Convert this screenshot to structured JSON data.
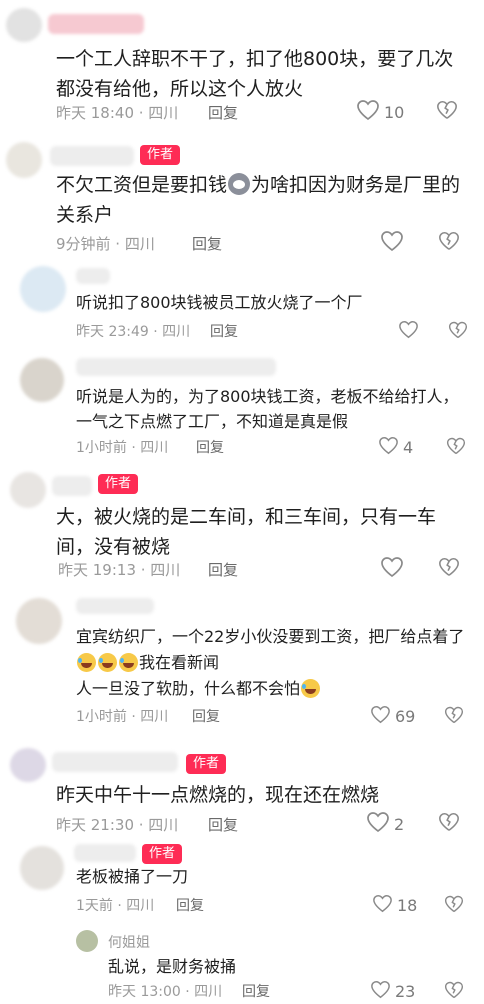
{
  "colors": {
    "accent": "#fe2c55",
    "meta": "#9a9a9a",
    "text": "#1f1f1f"
  },
  "comments": [
    {
      "author_badge": "",
      "text": "一个工人辞职不干了，扣了他800块，要了几次都没有给他，所以这个人放火",
      "time": "昨天 18:40 · 四川",
      "reply": "回复",
      "likes": "10"
    },
    {
      "author_badge": "作者",
      "text_a": "不欠工资但是要扣钱",
      "emoji": "cat-emoji",
      "text_b": "为啥扣因为财务是厂里的关系户",
      "time": "9分钟前 · 四川",
      "reply": "回复",
      "likes": ""
    },
    {
      "author_badge": "",
      "text": "听说扣了800块钱被员工放火烧了一个厂",
      "time": "昨天 23:49 · 四川",
      "reply": "回复",
      "likes": ""
    },
    {
      "author_badge": "",
      "text": "听说是人为的，为了800块钱工资，老板不给给打人，一气之下点燃了工厂，不知道是真是假",
      "time": "1小时前 · 四川",
      "reply": "回复",
      "likes": "4"
    },
    {
      "author_badge": "作者",
      "text": "大，被火烧的是二车间，和三车间，只有一车间，没有被烧",
      "time": "昨天 19:13 · 四川",
      "reply": "回复",
      "likes": ""
    },
    {
      "author_badge": "",
      "text_a": "宜宾纺织厂，一个22岁小伙没要到工资，把厂给点着了",
      "emoji": "laughing-tears-emoji",
      "text_b": "我在看新闻",
      "text_c": "人一旦没了软肋，什么都不会怕",
      "time": "1小时前 · 四川",
      "reply": "回复",
      "likes": "69"
    },
    {
      "author_badge": "作者",
      "text": "昨天中午十一点燃烧的，现在还在燃烧",
      "time": "昨天 21:30 · 四川",
      "reply": "回复",
      "likes": "2"
    },
    {
      "author_badge": "作者",
      "text": "老板被捅了一刀",
      "time": "1天前 · 四川",
      "reply": "回复",
      "likes": "18"
    },
    {
      "author": "何姐姐",
      "text": "乱说，是财务被捅",
      "time": "昨天 13:00 · 四川",
      "reply": "回复",
      "likes": "23"
    }
  ]
}
